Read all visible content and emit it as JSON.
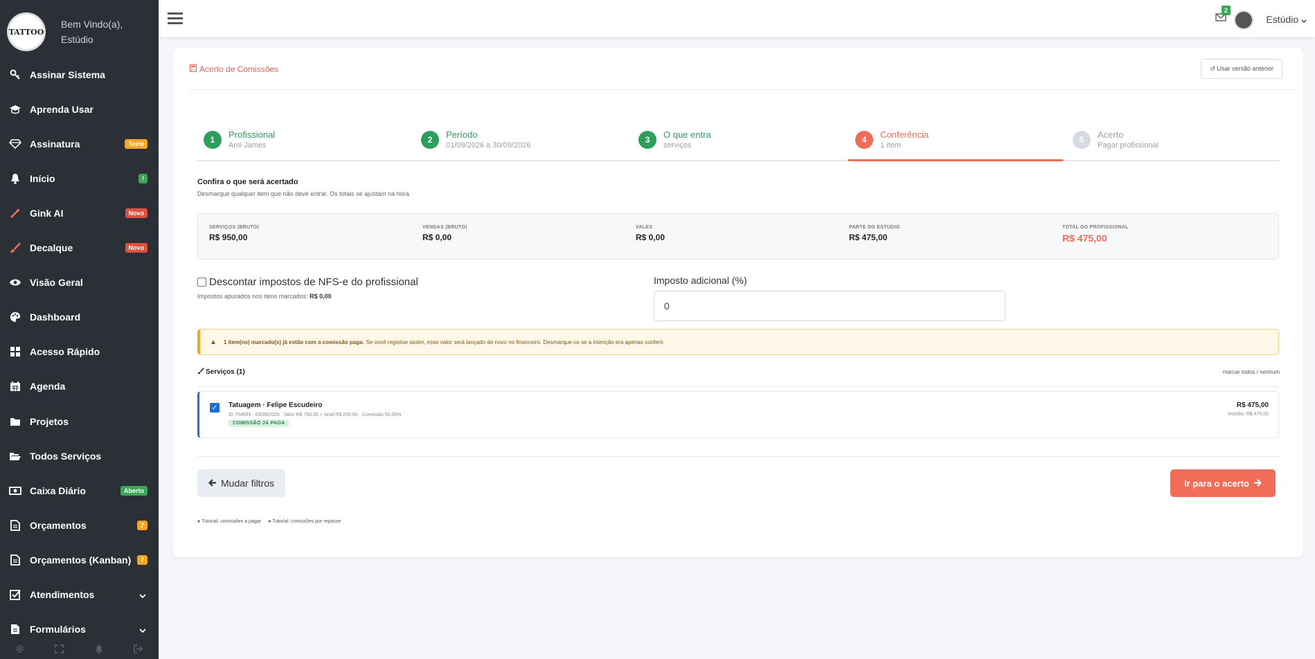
{
  "sidebar": {
    "welcome_line1": "Bem Vindo(a),",
    "welcome_line2": "Estúdio",
    "logo_text": "TATTOO",
    "items": [
      {
        "label": "Assinar Sistema",
        "icon": "key-icon"
      },
      {
        "label": "Aprenda Usar",
        "icon": "graduation-cap-icon"
      },
      {
        "label": "Assinatura",
        "icon": "diamond-icon",
        "badge": "Teste"
      },
      {
        "label": "Início",
        "icon": "bell-icon",
        "badge": "!"
      },
      {
        "label": "Gink AI",
        "icon": "magic-wand-icon",
        "badge": "Novo"
      },
      {
        "label": "Decalque",
        "icon": "brush-icon",
        "badge": "Novo"
      },
      {
        "label": "Visão Geral",
        "icon": "eye-icon"
      },
      {
        "label": "Dashboard",
        "icon": "palette-icon"
      },
      {
        "label": "Acesso Rápido",
        "icon": "grid-icon"
      },
      {
        "label": "Agenda",
        "icon": "calendar-icon"
      },
      {
        "label": "Projetos",
        "icon": "folder-icon"
      },
      {
        "label": "Todos Serviços",
        "icon": "folder-open-icon"
      },
      {
        "label": "Caixa Diário",
        "icon": "money-icon",
        "badge": "Aberto"
      },
      {
        "label": "Orçamentos",
        "icon": "file-icon",
        "badge": "7"
      },
      {
        "label": "Orçamentos (Kanban)",
        "icon": "file-icon",
        "badge": "7"
      },
      {
        "label": "Atendimentos",
        "icon": "check-square-icon"
      },
      {
        "label": "Formulários",
        "icon": "file-text-icon"
      }
    ]
  },
  "topbar": {
    "mail_count": "2",
    "user_name": "Estúdio"
  },
  "page": {
    "title": "Acerto de Comissões",
    "prev_version": "Usar versão anterior"
  },
  "steps": [
    {
      "num": "1",
      "title": "Profissional",
      "sub": "Ami James"
    },
    {
      "num": "2",
      "title": "Período",
      "sub": "01/09/2026 a 30/09/2026"
    },
    {
      "num": "3",
      "title": "O que entra",
      "sub": "serviços"
    },
    {
      "num": "4",
      "title": "Conferência",
      "sub": "1 item"
    },
    {
      "num": "5",
      "title": "Acerto",
      "sub": "Pagar profissional"
    }
  ],
  "review": {
    "title": "Confira o que será acertado",
    "subtitle": "Desmarque qualquer item que não deve entrar. Os totais se ajustam na hora."
  },
  "summary": [
    {
      "label": "SERVIÇOS (BRUTO)",
      "value": "R$ 950,00"
    },
    {
      "label": "VENDAS (BRUTO)",
      "value": "R$ 0,00"
    },
    {
      "label": "VALES",
      "value": "R$ 0,00"
    },
    {
      "label": "PARTE DO ESTÚDIO",
      "value": "R$ 475,00"
    },
    {
      "label": "TOTAL DO PROFISSIONAL",
      "value": "R$ 475,00"
    }
  ],
  "tax": {
    "checkbox_label": "Descontar impostos de NFS-e do profissional",
    "note_prefix": "Impostos apurados nos itens marcados:",
    "note_value": "R$ 0,00",
    "additional_label": "Imposto adicional (%)",
    "additional_value": "0"
  },
  "alert": {
    "bold": "1 item(ns) marcado(s) já estão com a comissão paga.",
    "text": "Se você registrar assim, esse valor será lançado de novo no financeiro. Desmarque-os se a intenção era apenas conferir."
  },
  "services": {
    "header": "Serviços (1)",
    "toggle": "marcar todos / nenhum",
    "items": [
      {
        "name": "Tatuagem · Felipe Escudeiro",
        "meta": "ID 754699 · 03/09/2026 · Valor R$ 750,00 + sinal R$ 200,00 · Comissão 50,00%",
        "tag": "COMISSÃO JÁ PAGA",
        "amount": "R$ 475,00",
        "studio": "estúdio: R$ 475,00"
      }
    ]
  },
  "actions": {
    "back": "Mudar filtros",
    "go": "Ir para o acerto"
  },
  "tutorials": [
    "Tutorial: comissões a pagar",
    "Tutorial: comissões por repasse"
  ],
  "colors": {
    "accent": "#f26d58",
    "success": "#2e9e5b",
    "sidebar": "#2b3036",
    "link_blue": "#1e6fd9"
  }
}
